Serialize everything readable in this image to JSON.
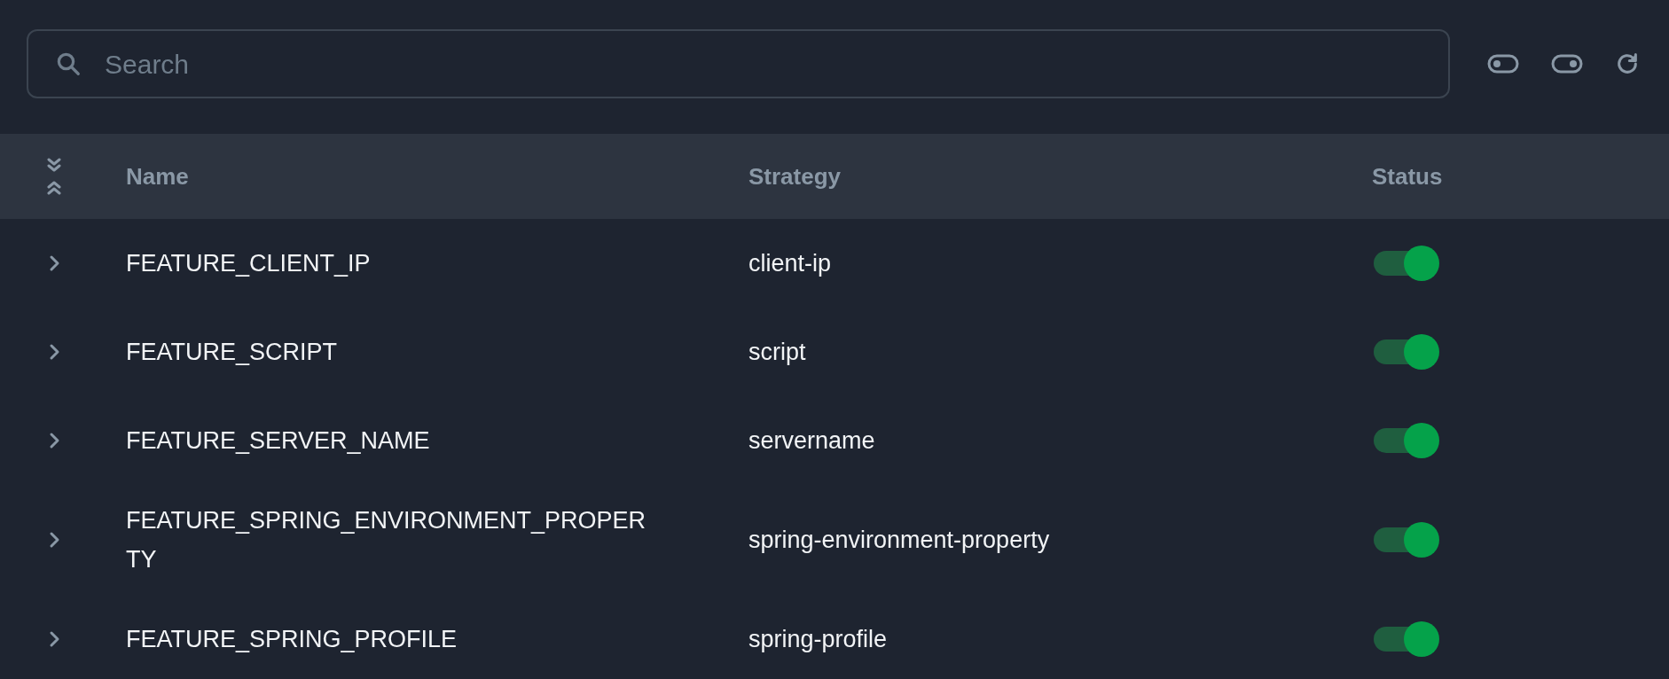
{
  "search": {
    "placeholder": "Search"
  },
  "toolbar": [
    {
      "kind": "toggle-off"
    },
    {
      "kind": "toggle-on"
    },
    {
      "kind": "refresh"
    }
  ],
  "table": {
    "columns": [
      "Name",
      "Strategy",
      "Status"
    ],
    "rows": [
      {
        "name": "FEATURE_CLIENT_IP",
        "strategy": "client-ip",
        "on": true,
        "expanded": false
      },
      {
        "name": "FEATURE_SCRIPT",
        "strategy": "script",
        "on": true,
        "expanded": false
      },
      {
        "name": "FEATURE_SERVER_NAME",
        "strategy": "servername",
        "on": true,
        "expanded": false
      },
      {
        "name": "FEATURE_SPRING_ENVIRONMENT_PROPERTY",
        "strategy": "spring-environment-property",
        "on": true,
        "expanded": false
      },
      {
        "name": "FEATURE_SPRING_PROFILE",
        "strategy": "spring-profile",
        "on": true,
        "expanded": false
      }
    ]
  }
}
